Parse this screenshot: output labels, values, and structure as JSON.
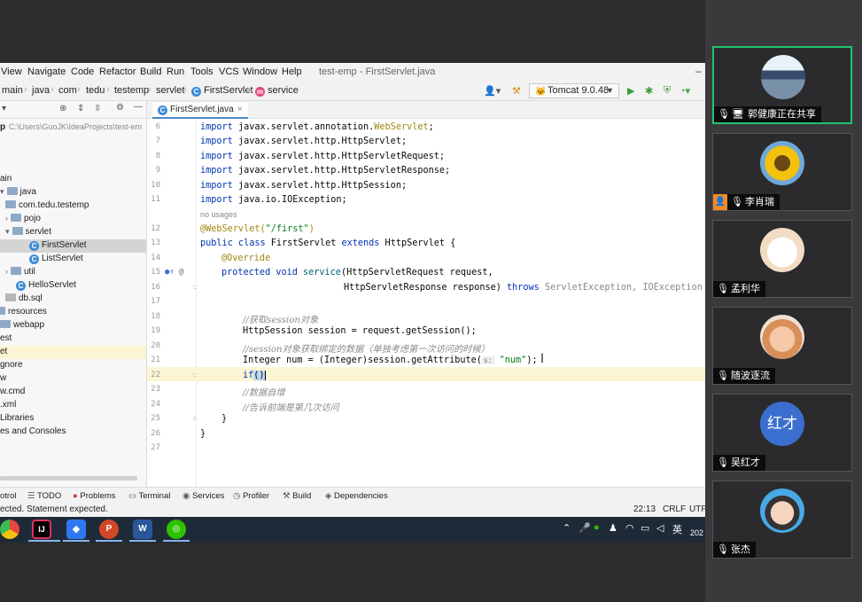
{
  "ide": {
    "menus": [
      "View",
      "Navigate",
      "Code",
      "Refactor",
      "Build",
      "Run",
      "Tools",
      "VCS",
      "Window",
      "Help"
    ],
    "window_title": "test-emp - FirstServlet.java",
    "breadcrumbs": [
      "main",
      "java",
      "com",
      "tedu",
      "testemp",
      "servlet",
      "FirstServlet",
      "service"
    ],
    "run_config": "Tomcat 9.0.48",
    "project_path": "C:\\Users\\GuoJK\\IdeaProjects\\test-em",
    "project_root_fragment": "p",
    "tree": [
      {
        "label": "ain"
      },
      {
        "label": "java"
      },
      {
        "label": "com.tedu.testemp"
      },
      {
        "label": "pojo"
      },
      {
        "label": "servlet"
      },
      {
        "label": "FirstServlet"
      },
      {
        "label": "ListServlet"
      },
      {
        "label": "util"
      },
      {
        "label": "HelloServlet"
      },
      {
        "label": "db.sql"
      },
      {
        "label": "resources"
      },
      {
        "label": "webapp"
      },
      {
        "label": "est"
      },
      {
        "label": "et"
      },
      {
        "label": "gnore"
      },
      {
        "label": "w"
      },
      {
        "label": "w.cmd"
      },
      {
        "label": ".xml"
      },
      {
        "label": "Libraries"
      },
      {
        "label": "es and Consoles"
      }
    ],
    "tab": {
      "label": "FirstServlet.java",
      "close": "×"
    },
    "line_numbers": [
      "6",
      "7",
      "8",
      "9",
      "10",
      "11",
      "12",
      "13",
      "14",
      "15",
      "16",
      "17",
      "18",
      "19",
      "20",
      "21",
      "22",
      "23",
      "24",
      "25",
      "26",
      "27"
    ],
    "code": {
      "l6_kw": "import",
      "l6": " javax.servlet.annotation.",
      "l6_ann": "WebServlet",
      "l6_end": ";",
      "l7_kw": "import",
      "l7": " javax.servlet.http.HttpServlet;",
      "l8_kw": "import",
      "l8": " javax.servlet.http.HttpServletRequest;",
      "l9_kw": "import",
      "l9": " javax.servlet.http.HttpServletResponse;",
      "l10_kw": "import",
      "l10": " javax.servlet.http.HttpSession;",
      "l11_kw": "import",
      "l11": " java.io.IOException;",
      "no_usages": "no usages",
      "l12_ann": "@WebServlet(",
      "l12_str": "\"/first\"",
      "l12_end": ")",
      "l13_kw": "public class",
      "l13": " FirstServlet ",
      "l13_kw2": "extends",
      "l13_end": " HttpServlet {",
      "l14_ann": "@Override",
      "l15_kw": "protected void",
      "l15_fn": " service",
      "l15": "(HttpServletRequest request,",
      "l16": "HttpServletResponse response) ",
      "l16_kw": "throws",
      "l16_gr": " ServletException, IOException",
      "l16_end": " {",
      "l18_cm": "//获取session对象",
      "l19": "HttpSession session = request.getSession();",
      "l20_cm": "//session对象获取绑定的数据（单独考虑第一次访问的时候）",
      "l21": "Integer num = (Integer)session.getAttribute(",
      "l21_hint": "s:",
      "l21_str": " \"num\"",
      "l21_end": ");",
      "l22_kw": "if",
      "l22_brk": "()",
      "l23_cm": "//数据自增",
      "l24_cm": "//告诉前端是第几次访问",
      "l25": "}",
      "l26": "}"
    },
    "bottom_tools": [
      "otrol",
      "TODO",
      "Problems",
      "Terminal",
      "Services",
      "Profiler",
      "Build",
      "Dependencies"
    ],
    "status_msg": "ected. Statement expected.",
    "status_right": [
      "22:13",
      "CRLF",
      "UTF"
    ]
  },
  "taskbar": {
    "ime": "英",
    "year_fragment": "202"
  },
  "meeting": {
    "participants": [
      {
        "name": "郭健康正在共享"
      },
      {
        "name": "李肖瑞"
      },
      {
        "name": "孟利华"
      },
      {
        "name": "随波逐流"
      },
      {
        "name": "吴红才",
        "avatar_text": "红才"
      },
      {
        "name": "张杰"
      }
    ]
  }
}
